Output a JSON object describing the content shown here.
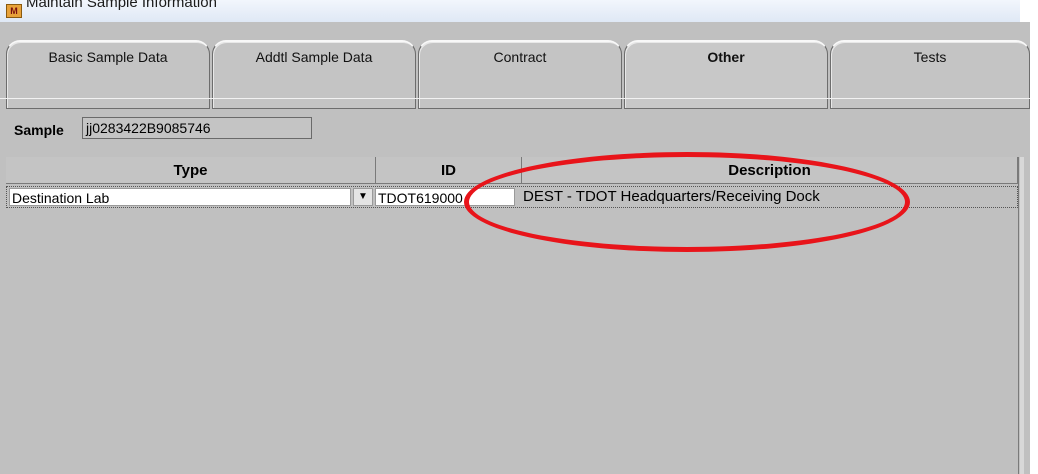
{
  "window": {
    "title": "Maintain Sample Information",
    "icon": "app-icon",
    "icon_letter": "M"
  },
  "tabs": [
    {
      "label": "Basic Sample Data",
      "active": false
    },
    {
      "label": "Addtl Sample Data",
      "active": false
    },
    {
      "label": "Contract",
      "active": false
    },
    {
      "label": "Other",
      "active": true
    },
    {
      "label": "Tests",
      "active": false
    }
  ],
  "sample": {
    "label": "Sample",
    "value": "jj0283422B9085746"
  },
  "grid": {
    "columns": [
      "Type",
      "ID",
      "Description"
    ],
    "rows": [
      {
        "type": "Destination Lab",
        "id": "TDOT619000",
        "description": "DEST - TDOT Headquarters/Receiving Dock"
      }
    ]
  },
  "annotation": {
    "color": "#e8141a",
    "shape": "red-ellipse-highlight"
  },
  "icons": {
    "dropdown": "dropdown-arrow-icon"
  }
}
